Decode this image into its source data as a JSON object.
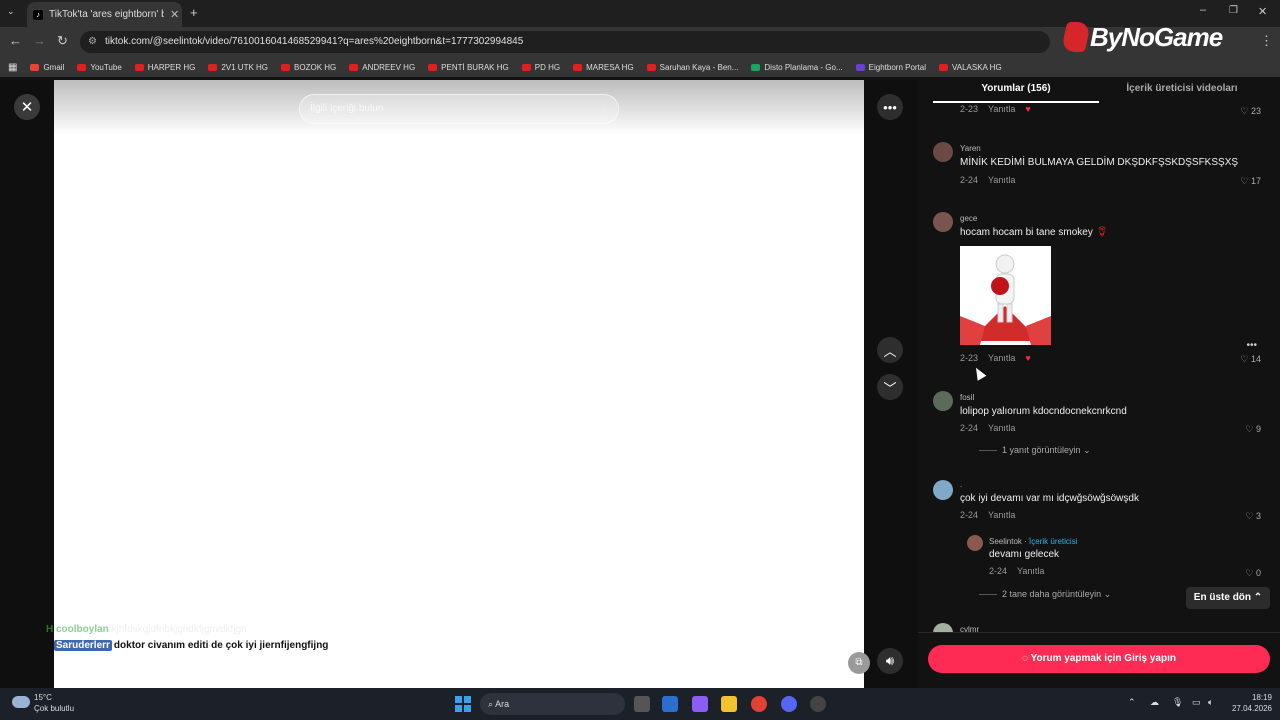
{
  "browser": {
    "tab_title": "TikTok'ta 'ares eightborn' bulab",
    "url": "tiktok.com/@seelintok/video/7610016041468529941?q=ares%20eightborn&t=1777302994845",
    "logo_text": "ByNoGame",
    "bookmarks": [
      "Gmail",
      "YouTube",
      "HARPER HG",
      "2V1 UTK HG",
      "BOZOK HG",
      "ANDREEV HG",
      "PENTİ BURAK HG",
      "PD HG",
      "MARESA HG",
      "Saruhan Kaya - Ben...",
      "Disto Planlama - Go...",
      "Eightborn Portal",
      "VALASKA HG"
    ]
  },
  "video": {
    "search_placeholder": "İlgili içeriği bulun",
    "caption_faded_name": "H coolboylan",
    "caption_faded_text": "kjhfdskgjdfnbkjgndkfjgnvdkfjgn",
    "caption_name": "Saruderlerr",
    "caption_text": "doktor civanım editi de çok iyi jiernfijengfijng"
  },
  "panel": {
    "tab_comments": "Yorumlar (156)",
    "tab_creator": "İçerik üreticisi videoları",
    "reply_label": "Yanıtla",
    "comments": [
      {
        "user": "",
        "text": "",
        "date": "2-23",
        "likes": "23"
      },
      {
        "user": "Yaren",
        "text": "MİNİK KEDİMİ BULMAYA GELDİM DKŞDKFŞSKDŞSFKSŞXŞ",
        "date": "2-24",
        "likes": "17"
      },
      {
        "user": "gece",
        "text": "hocam hocam bi tane smokey",
        "date": "2-23",
        "likes": "14"
      },
      {
        "user": "fosil",
        "text": "lolipop yalıorum kdocndocnekcnrkcnd",
        "date": "2-24",
        "likes": "9",
        "more": "1 yanıt görüntüleyin"
      },
      {
        "user": ".",
        "text": "çok iyi devamı var mı idçwğsöwğsöwşdk",
        "date": "2-24",
        "likes": "3"
      },
      {
        "user": "Seelintok",
        "badge": "İçerik üreticisi",
        "text": "devamı gelecek",
        "date": "2-24",
        "likes": "0",
        "more": "2 tane daha görüntüleyin"
      },
      {
        "user": "cvlmr",
        "text": "",
        "date": "",
        "likes": ""
      }
    ],
    "to_top": "En üste dön",
    "login_button": "Yorum yapmak için Giriş yapın"
  },
  "taskbar": {
    "temp": "15°C",
    "weather": "Çok bulutlu",
    "search": "Ara",
    "time": "18:19",
    "date": "27.04.2026"
  }
}
